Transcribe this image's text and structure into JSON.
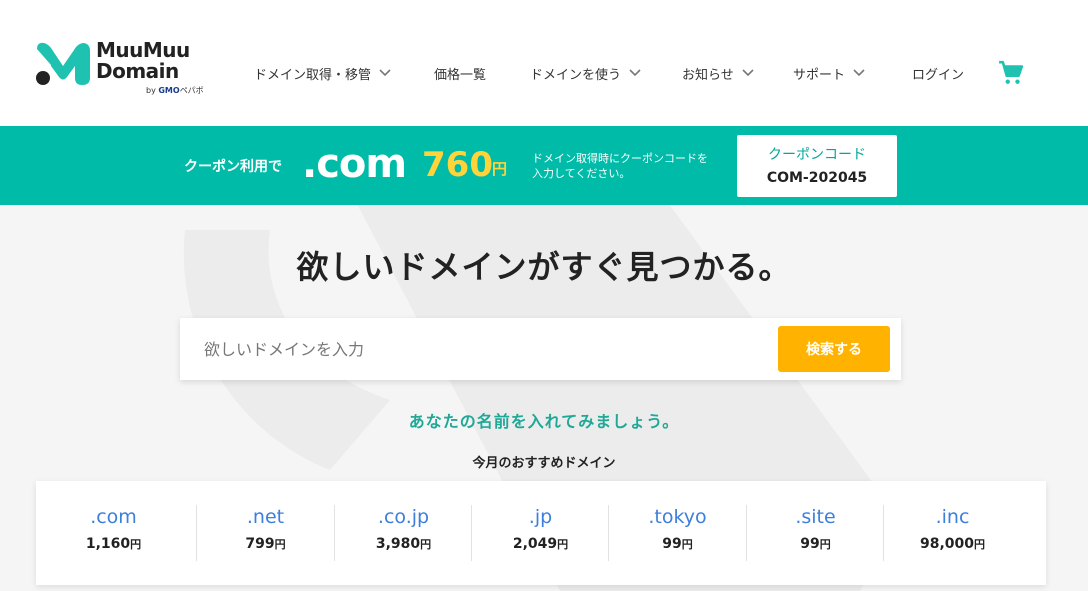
{
  "logo": {
    "line1": "MuuMuu",
    "line2": "Domain",
    "by": "by",
    "gmo": "GMO",
    "pepabo": "ペパボ"
  },
  "nav": [
    {
      "label": "ドメイン取得・移管",
      "dropdown": true
    },
    {
      "label": "価格一覧",
      "dropdown": false
    },
    {
      "label": "ドメインを使う",
      "dropdown": true
    },
    {
      "label": "お知らせ",
      "dropdown": true
    },
    {
      "label": "サポート",
      "dropdown": true
    },
    {
      "label": "ログイン",
      "dropdown": false
    }
  ],
  "cart_icon": "shopping-cart-icon",
  "banner": {
    "label": "クーポン利用で",
    "tld": ".com",
    "price": "760",
    "yen": "円",
    "note_line1": "ドメイン取得時にクーポンコードを",
    "note_line2": "入力してください。",
    "coupon_title": "クーポンコード",
    "coupon_code": "COM-202045"
  },
  "hero": {
    "title": "欲しいドメインがすぐ見つかる。",
    "placeholder": "欲しいドメインを入力",
    "search_value": "",
    "search_button": "検索する",
    "hint": "あなたの名前を入れてみましょう。"
  },
  "recommend": {
    "title": "今月のおすすめドメイン",
    "yen": "円",
    "items": [
      {
        "tld": ".com",
        "price": "1,160"
      },
      {
        "tld": ".net",
        "price": "799"
      },
      {
        "tld": ".co.jp",
        "price": "3,980"
      },
      {
        "tld": ".jp",
        "price": "2,049"
      },
      {
        "tld": ".tokyo",
        "price": "99"
      },
      {
        "tld": ".site",
        "price": "99"
      },
      {
        "tld": ".inc",
        "price": "98,000"
      }
    ]
  },
  "colors": {
    "brand": "#00bba8",
    "accent": "#ffb300",
    "price_yellow": "#ffd43b",
    "link_blue": "#3d7fdc"
  }
}
